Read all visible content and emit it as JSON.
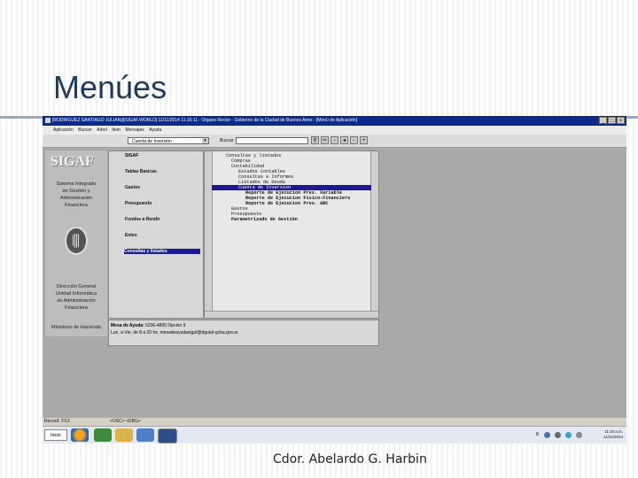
{
  "slide": {
    "title": "Menúes",
    "footer": "Cdor. Abelardo G. Harbin"
  },
  "window": {
    "title": "[RODRIGUEZ SANTIAGO JULIAN@SIGAF.WORLD] 11/11/2014 11:16:11 - Organo Rector - Gobierno de la Ciudad de Buenos Aires - [Menú de Aplicación]",
    "menu": [
      "Aplicación",
      "Buscar",
      "Arbol",
      "Item",
      "Mensajes",
      "Ayuda"
    ],
    "toolbar": {
      "dropdown_value": "Cuenta de Inversión",
      "search_label": "Buscar",
      "search_value": ""
    }
  },
  "left_panel": {
    "logo": "SIGAF",
    "system_name": [
      "Sistema Integrado",
      "de Gestión y",
      "Administración",
      "Financiera"
    ],
    "direccion": [
      "Dirección General",
      "Unidad Informática",
      "de Administración",
      "Financiera"
    ],
    "ministerio": "Ministerio de Hacienda"
  },
  "mid_panel": {
    "header": "SIGAF",
    "items": [
      "Tablas Basicas",
      "Gastos",
      "Presupuesto",
      "Fondos a Rendir",
      "Entes",
      "Consultas y listados"
    ],
    "selected_index": 5
  },
  "tree": {
    "lines": [
      "Consultas y listados",
      "Compras",
      "Contabilidad",
      "Estados Contables",
      "Consultas e Informes",
      "Listados de Deuda",
      "Cuenta de Inversion",
      "Reporte de Ejecucion Pres. Variable",
      "Reporte de Ejecucion Fisico-Financiero",
      "Reporte de Ejecucion Pres. ABC",
      "Gastos",
      "Presupuesto",
      "Parametrizado de Gestión"
    ],
    "selected_index": 6
  },
  "info": {
    "label": "Mesa de Ayuda:",
    "phone": "5236-4800 Opción 9",
    "hours": "Lun. a Vie. de 8 a 20 hs. mesadeayudasigaf@dguiaf-gcba.gov.ar"
  },
  "status": {
    "record": "Record: 7/13",
    "tags": "<OSC> <DBG>"
  },
  "taskbar": {
    "start": "Inicio",
    "time": "11:15 a.m.",
    "date": "11/11/2014",
    "tray_number": "8"
  },
  "colors": {
    "titlebar": "#0a2a8c",
    "selection": "#1a1a8c",
    "slide_title": "#1f3b5c"
  }
}
